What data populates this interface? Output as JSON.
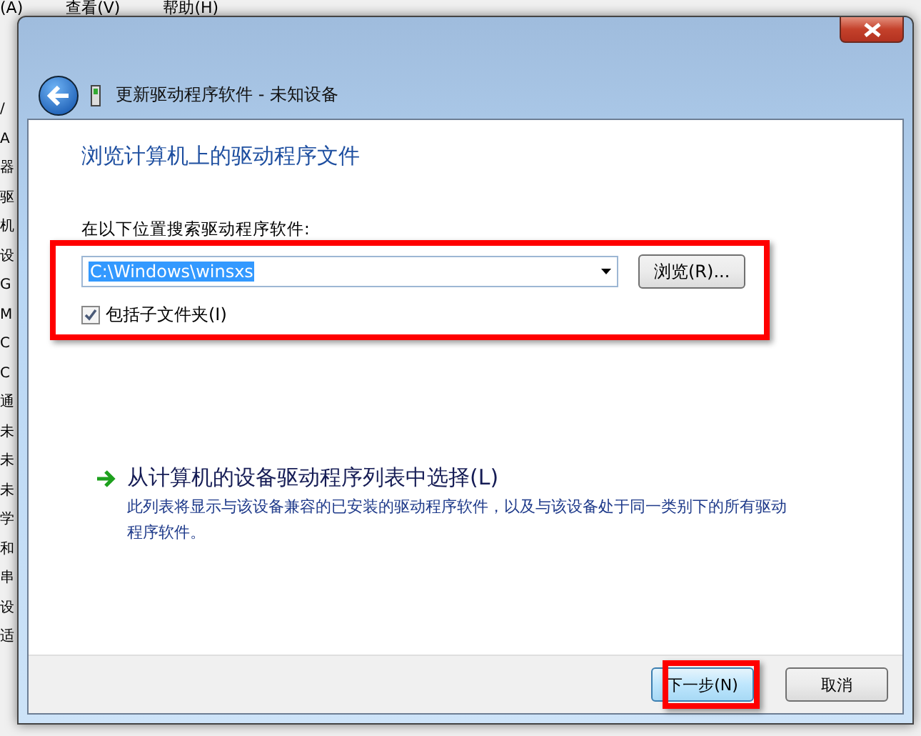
{
  "background_window": {
    "menu": [
      "(A)",
      "查看(V)",
      "帮助(H)"
    ],
    "list_fragments": [
      "/",
      "A",
      "器",
      "驱",
      "机",
      "设",
      "G",
      "M",
      "C",
      "C",
      "通",
      "未",
      "未",
      "未",
      "学",
      "和",
      "串",
      "设",
      "适"
    ]
  },
  "dialog": {
    "title": "更新驱动程序软件 - 未知设备",
    "heading": "浏览计算机上的驱动程序文件",
    "search_label": "在以下位置搜索驱动程序软件:",
    "path_value": "C:\\Windows\\winsxs",
    "browse_button": "浏览(R)...",
    "include_subfolders": {
      "label": "包括子文件夹(I)",
      "checked": true
    },
    "pick_option": {
      "title": "从计算机的设备驱动程序列表中选择(L)",
      "description": "此列表将显示与该设备兼容的已安装的驱动程序软件，以及与该设备处于同一类别下的所有驱动程序软件。"
    },
    "buttons": [
      {
        "label": "下一步(N)",
        "kind": "default"
      },
      {
        "label": "取消",
        "kind": "normal"
      }
    ]
  }
}
